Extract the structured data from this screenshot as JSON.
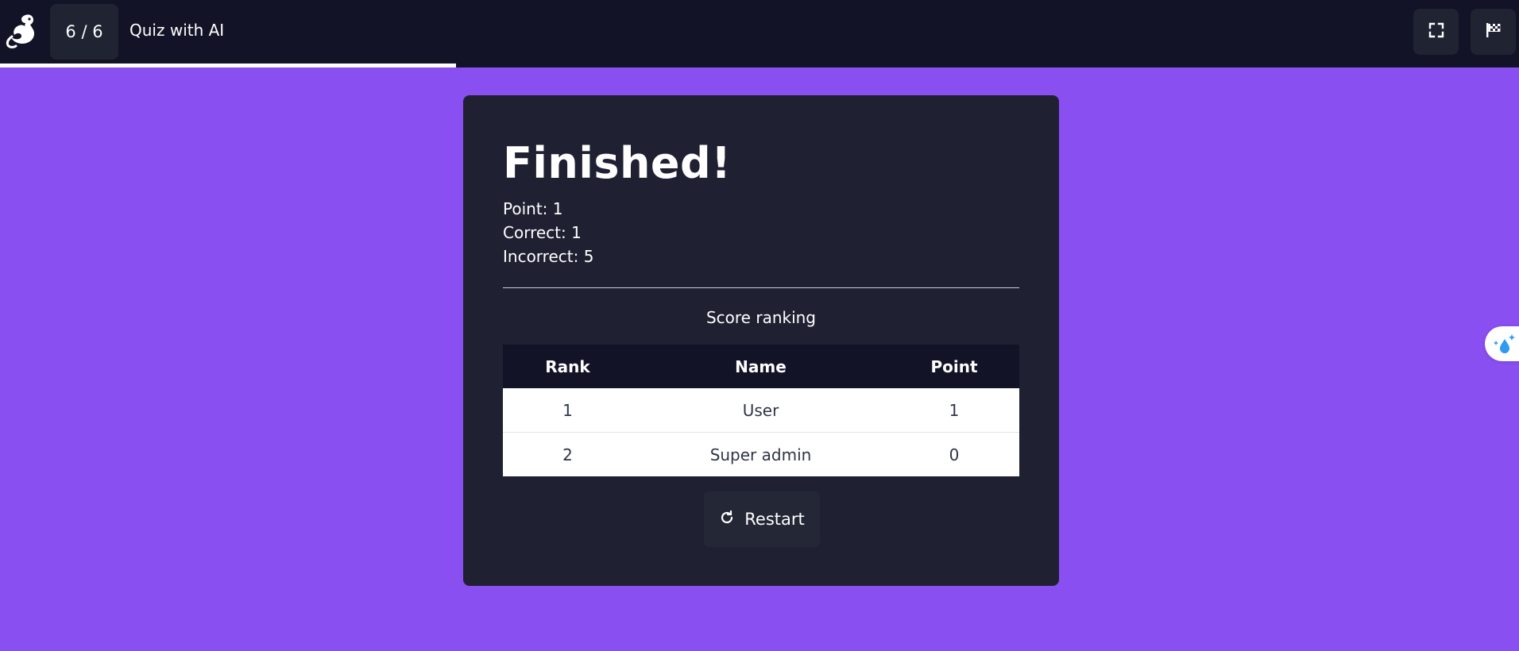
{
  "header": {
    "logo_icon": "lizard-logo-icon",
    "question_counter": "6 / 6",
    "title": "Quiz with AI",
    "progress_fraction": 0.3,
    "fullscreen_icon": "fullscreen-icon",
    "finish_icon": "checkered-flag-icon"
  },
  "result": {
    "title": "Finished!",
    "point": "Point: 1",
    "correct": "Correct: 1",
    "incorrect": "Incorrect: 5"
  },
  "ranking": {
    "caption": "Score ranking",
    "columns": [
      "Rank",
      "Name",
      "Point"
    ],
    "rows": [
      [
        "1",
        "User",
        "1"
      ],
      [
        "2",
        "Super admin",
        "0"
      ]
    ]
  },
  "actions": {
    "restart_label": "Restart",
    "restart_icon": "restart-arrow-icon"
  },
  "side_widget": {
    "icon": "water-drop-sparkle-icon"
  },
  "colors": {
    "background": "#894ff1",
    "topbar": "#121326",
    "card": "#1f2133",
    "button": "#1f2332",
    "widget_accent": "#2f9bf0"
  }
}
